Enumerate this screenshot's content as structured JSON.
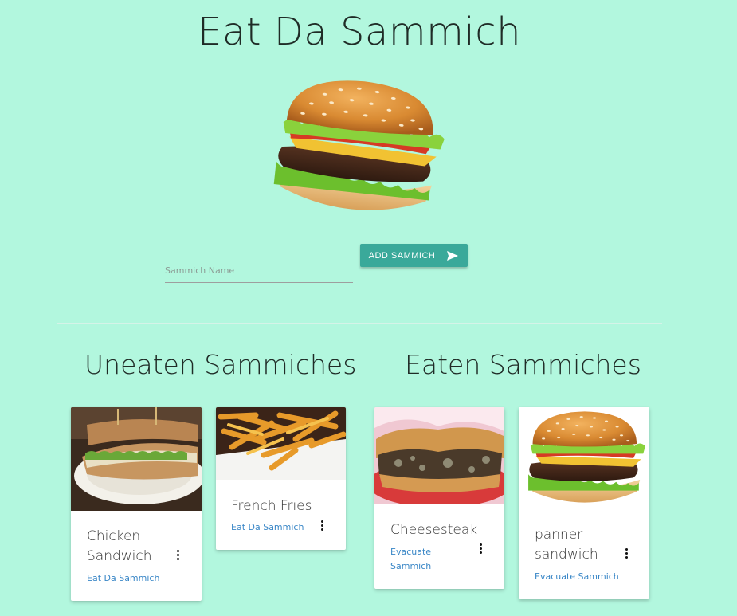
{
  "header": {
    "title": "Eat Da Sammich"
  },
  "form": {
    "name_placeholder": "Sammich Name",
    "name_value": "",
    "add_label": "ADD SAMMICH"
  },
  "colors": {
    "background": "#b2f7de",
    "button": "#3aa99a",
    "link": "#3a87c7"
  },
  "sections": {
    "uneaten": {
      "title": "Uneaten Sammiches",
      "items": [
        {
          "name": "Chicken Sandwich",
          "action": "Eat Da Sammich",
          "image": "chicken-sandwich-photo"
        },
        {
          "name": "French Fries",
          "action": "Eat Da Sammich",
          "image": "french-fries-photo"
        }
      ]
    },
    "eaten": {
      "title": "Eaten Sammiches",
      "items": [
        {
          "name": "Cheesesteak",
          "action": "Evacuate Sammich",
          "image": "cheesesteak-photo"
        },
        {
          "name": "panner sandwich",
          "action": "Evacuate Sammich",
          "image": "burger-photo"
        }
      ]
    }
  }
}
